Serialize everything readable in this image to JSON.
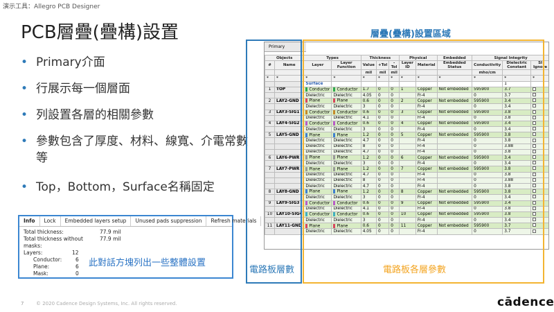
{
  "window_title": "演示工具：Allegro PCB Designer",
  "slide": {
    "title": "PCB層疊(疊構)設置",
    "bullets": [
      "Primary介面",
      "行展示每一個層面",
      "列設置各層的相關參數",
      "參數包含了厚度、材料、線寬、介電常數等",
      "Top，Bottom，Surface名稱固定"
    ],
    "bullet_symbol": "•"
  },
  "info_dialog": {
    "tabs": [
      "Info",
      "Lock",
      "Embedded layers setup",
      "Unused pads suppression",
      "Refresh materials"
    ],
    "rows": [
      {
        "label": "Total thickness:",
        "value": "77.9 mil"
      },
      {
        "label": "Total thickness without masks:",
        "value": "77.9 mil"
      },
      {
        "label": "Layers:",
        "value": "12"
      }
    ],
    "sub_rows": [
      {
        "label": "Conductor:",
        "value": "6"
      },
      {
        "label": "Plane:",
        "value": "6"
      },
      {
        "label": "Mask:",
        "value": "0"
      }
    ],
    "note": "此對話方塊列出一些整體設置"
  },
  "grid": {
    "tab": "Primary",
    "group_headers": [
      "Objects",
      "Types",
      "Thickness",
      "Physical",
      "Embedded",
      "Signal Integrity"
    ],
    "col_headers": [
      "#",
      "Name",
      "Layer",
      "Layer Function",
      "Value",
      "+Tol",
      "-Tol",
      "Layer ID",
      "Material",
      "Embedded Status",
      "Conductivity",
      "Dielectric Constant",
      "SI Ignore"
    ],
    "unit_headers": [
      "",
      "",
      "",
      "",
      "mil",
      "mil",
      "mil",
      "",
      "",
      "",
      "mho/cm",
      "",
      ""
    ],
    "filter_symbol": "*",
    "rows": [
      {
        "kind": "surf",
        "num": "",
        "name": "",
        "layer": "Surface",
        "func": "",
        "val": "",
        "ptol": "",
        "mtol": "",
        "id": "",
        "mat": "",
        "emb": "",
        "cond": "",
        "dk": "1",
        "si": false
      },
      {
        "kind": "cond",
        "num": "1",
        "name": "TOP",
        "layer": "Conductor",
        "func": "Conductor",
        "val": "1.7",
        "ptol": "0",
        "mtol": "0",
        "id": "1",
        "mat": "Copper",
        "emb": "Not embedded",
        "cond": "595900",
        "dk": "3.7",
        "si": true,
        "color": "#2fa84f"
      },
      {
        "kind": "diel",
        "num": "",
        "name": "",
        "layer": "Dielectric",
        "func": "Dielectric",
        "val": "4.05",
        "ptol": "0",
        "mtol": "0",
        "id": "",
        "mat": "Fr-4",
        "emb": "",
        "cond": "0",
        "dk": "3.7",
        "si": true
      },
      {
        "kind": "plane",
        "num": "2",
        "name": "LAY2-GND",
        "layer": "Plane",
        "func": "Plane",
        "val": "0.6",
        "ptol": "0",
        "mtol": "0",
        "id": "2",
        "mat": "Copper",
        "emb": "Not embedded",
        "cond": "595900",
        "dk": "3.4",
        "si": true,
        "color": "#d9465e"
      },
      {
        "kind": "diel",
        "num": "",
        "name": "",
        "layer": "Dielectric",
        "func": "Dielectric",
        "val": "3",
        "ptol": "0",
        "mtol": "0",
        "id": "",
        "mat": "Fr-4",
        "emb": "",
        "cond": "0",
        "dk": "3.4",
        "si": true
      },
      {
        "kind": "cond",
        "num": "3",
        "name": "LAY3-SIG1",
        "layer": "Conductor",
        "func": "Conductor",
        "val": "0.6",
        "ptol": "0",
        "mtol": "0",
        "id": "3",
        "mat": "Copper",
        "emb": "Not embedded",
        "cond": "595900",
        "dk": "3.8",
        "si": true,
        "color": "#c58a2a"
      },
      {
        "kind": "diel",
        "num": "",
        "name": "",
        "layer": "Dielectric",
        "func": "Dielectric",
        "val": "4.1",
        "ptol": "0",
        "mtol": "0",
        "id": "",
        "mat": "Fr-4",
        "emb": "",
        "cond": "0",
        "dk": "3.8",
        "si": true
      },
      {
        "kind": "cond",
        "num": "4",
        "name": "LAY4-SIG2",
        "layer": "Conductor",
        "func": "Conductor",
        "val": "0.6",
        "ptol": "0",
        "mtol": "0",
        "id": "4",
        "mat": "Copper",
        "emb": "Not embedded",
        "cond": "595900",
        "dk": "3.4",
        "si": true,
        "color": "#b85bc8"
      },
      {
        "kind": "diel",
        "num": "",
        "name": "",
        "layer": "Dielectric",
        "func": "Dielectric",
        "val": "3",
        "ptol": "0",
        "mtol": "0",
        "id": "",
        "mat": "Fr-4",
        "emb": "",
        "cond": "0",
        "dk": "3.4",
        "si": true
      },
      {
        "kind": "plane",
        "num": "5",
        "name": "LAY5-GND",
        "layer": "Plane",
        "func": "Plane",
        "val": "1.2",
        "ptol": "0",
        "mtol": "0",
        "id": "5",
        "mat": "Copper",
        "emb": "Not embedded",
        "cond": "595900",
        "dk": "3.8",
        "si": true,
        "color": "#3f7fd0"
      },
      {
        "kind": "diel",
        "num": "",
        "name": "",
        "layer": "Dielectric",
        "func": "Dielectric",
        "val": "4.7",
        "ptol": "0",
        "mtol": "0",
        "id": "",
        "mat": "Fr-4",
        "emb": "",
        "cond": "0",
        "dk": "3.8",
        "si": true
      },
      {
        "kind": "diel",
        "num": "",
        "name": "",
        "layer": "Dielectric",
        "func": "Dielectric",
        "val": "8",
        "ptol": "0",
        "mtol": "0",
        "id": "",
        "mat": "Fr-4",
        "emb": "",
        "cond": "0",
        "dk": "3.88",
        "si": true
      },
      {
        "kind": "diel",
        "num": "",
        "name": "",
        "layer": "Dielectric",
        "func": "Dielectric",
        "val": "4.7",
        "ptol": "0",
        "mtol": "0",
        "id": "",
        "mat": "Fr-4",
        "emb": "",
        "cond": "0",
        "dk": "3.8",
        "si": true
      },
      {
        "kind": "plane",
        "num": "6",
        "name": "LAY6-PWR",
        "layer": "Plane",
        "func": "Plane",
        "val": "1.2",
        "ptol": "0",
        "mtol": "0",
        "id": "6",
        "mat": "Copper",
        "emb": "Not embedded",
        "cond": "595900",
        "dk": "3.4",
        "si": true,
        "color": "#999999"
      },
      {
        "kind": "diel",
        "num": "",
        "name": "",
        "layer": "Dielectric",
        "func": "Dielectric",
        "val": "3",
        "ptol": "0",
        "mtol": "0",
        "id": "",
        "mat": "Fr-4",
        "emb": "",
        "cond": "0",
        "dk": "3.4",
        "si": true
      },
      {
        "kind": "plane",
        "num": "7",
        "name": "LAY7-PWR",
        "layer": "Plane",
        "func": "Plane",
        "val": "1.2",
        "ptol": "0",
        "mtol": "0",
        "id": "7",
        "mat": "Copper",
        "emb": "Not embedded",
        "cond": "595900",
        "dk": "3.8",
        "si": true,
        "color": "#999999"
      },
      {
        "kind": "diel",
        "num": "",
        "name": "",
        "layer": "Dielectric",
        "func": "Dielectric",
        "val": "4.7",
        "ptol": "0",
        "mtol": "0",
        "id": "",
        "mat": "Fr-4",
        "emb": "",
        "cond": "0",
        "dk": "3.8",
        "si": true
      },
      {
        "kind": "diel",
        "num": "",
        "name": "",
        "layer": "Dielectric",
        "func": "Dielectric",
        "val": "8",
        "ptol": "0",
        "mtol": "0",
        "id": "",
        "mat": "Fr-4",
        "emb": "",
        "cond": "0",
        "dk": "3.88",
        "si": true
      },
      {
        "kind": "diel",
        "num": "",
        "name": "",
        "layer": "Dielectric",
        "func": "Dielectric",
        "val": "4.7",
        "ptol": "0",
        "mtol": "0",
        "id": "",
        "mat": "Fr-4",
        "emb": "",
        "cond": "0",
        "dk": "3.8",
        "si": true
      },
      {
        "kind": "plane",
        "num": "8",
        "name": "LAY8-GND",
        "layer": "Plane",
        "func": "Plane",
        "val": "1.2",
        "ptol": "0",
        "mtol": "0",
        "id": "8",
        "mat": "Copper",
        "emb": "Not embedded",
        "cond": "595900",
        "dk": "3.8",
        "si": true,
        "color": "#3f7fd0"
      },
      {
        "kind": "diel",
        "num": "",
        "name": "",
        "layer": "Dielectric",
        "func": "Dielectric",
        "val": "3",
        "ptol": "0",
        "mtol": "0",
        "id": "",
        "mat": "Fr-4",
        "emb": "",
        "cond": "0",
        "dk": "3.4",
        "si": true
      },
      {
        "kind": "cond",
        "num": "9",
        "name": "LAY9-SIG3",
        "layer": "Conductor",
        "func": "Conductor",
        "val": "0.6",
        "ptol": "0",
        "mtol": "0",
        "id": "9",
        "mat": "Copper",
        "emb": "Not embedded",
        "cond": "595900",
        "dk": "3.4",
        "si": true,
        "color": "#b85bc8"
      },
      {
        "kind": "diel",
        "num": "",
        "name": "",
        "layer": "Dielectric",
        "func": "Dielectric",
        "val": "4.1",
        "ptol": "0",
        "mtol": "0",
        "id": "",
        "mat": "Fr-4",
        "emb": "",
        "cond": "0",
        "dk": "3.8",
        "si": true
      },
      {
        "kind": "cond",
        "num": "10",
        "name": "LAY10-SIG4",
        "layer": "Conductor",
        "func": "Conductor",
        "val": "0.6",
        "ptol": "0",
        "mtol": "0",
        "id": "10",
        "mat": "Copper",
        "emb": "Not embedded",
        "cond": "595900",
        "dk": "3.8",
        "si": true,
        "color": "#3fb0c0"
      },
      {
        "kind": "diel",
        "num": "",
        "name": "",
        "layer": "Dielectric",
        "func": "Dielectric",
        "val": "3",
        "ptol": "0",
        "mtol": "0",
        "id": "",
        "mat": "Fr-4",
        "emb": "",
        "cond": "0",
        "dk": "3.4",
        "si": true
      },
      {
        "kind": "plane",
        "num": "11",
        "name": "LAY11-GND",
        "layer": "Plane",
        "func": "Plane",
        "val": "0.6",
        "ptol": "0",
        "mtol": "0",
        "id": "11",
        "mat": "Copper",
        "emb": "Not embedded",
        "cond": "595900",
        "dk": "3.7",
        "si": true,
        "color": "#d9465e"
      },
      {
        "kind": "diel",
        "num": "",
        "name": "",
        "layer": "Dielectric",
        "func": "Dielectric",
        "val": "4.05",
        "ptol": "0",
        "mtol": "0",
        "id": "",
        "mat": "Fr-4",
        "emb": "",
        "cond": "0",
        "dk": "3.7",
        "si": true
      }
    ]
  },
  "overlays": {
    "top_label": "層疊(疊構)設置區域",
    "left_label": "電路板層數",
    "right_label": "電路板各層參數",
    "blue_color": "#2e7ab8",
    "yellow_color": "#f3b431"
  },
  "footer": {
    "page_number": "7",
    "copyright": "© 2020 Cadence Design Systems, Inc. All rights reserved.",
    "logo": "cādence"
  }
}
